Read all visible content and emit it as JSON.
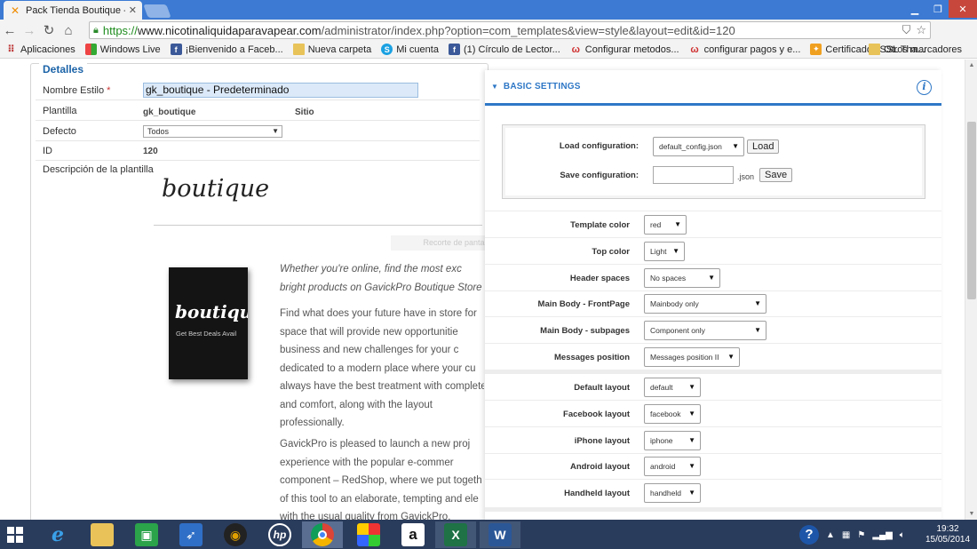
{
  "browser": {
    "tab_title": "Pack Tienda Boutique - A",
    "url_scheme": "https://",
    "url_host": "www.nicotinaliquidaparavapear.com",
    "url_path": "/administrator/index.php?option=com_templates&view=style&layout=edit&id=120",
    "bookmarks": [
      {
        "label": "Aplicaciones",
        "icon": "apps-grid-icon"
      },
      {
        "label": "Windows Live",
        "icon": "windows-logo-icon"
      },
      {
        "label": "¡Bienvenido a Faceb...",
        "icon": "facebook-icon"
      },
      {
        "label": "Nueva carpeta",
        "icon": "folder-icon"
      },
      {
        "label": "Mi cuenta",
        "icon": "skype-icon"
      },
      {
        "label": "(1) Círculo de Lector...",
        "icon": "facebook-icon"
      },
      {
        "label": "Configurar metodos...",
        "icon": "w-icon"
      },
      {
        "label": "configurar pagos y e...",
        "icon": "w-icon"
      },
      {
        "label": "Certificados SSL Tha...",
        "icon": "certificate-icon"
      }
    ],
    "other_bookmarks": "Otros marcadores"
  },
  "details": {
    "legend": "Detalles",
    "name_label": "Nombre Estilo",
    "name_required": "*",
    "name_value": "gk_boutique - Predeterminado",
    "template_label": "Plantilla",
    "template_value": "gk_boutique",
    "site_value": "Sitio",
    "default_label": "Defecto",
    "default_value": "Todos",
    "id_label": "ID",
    "id_value": "120",
    "description_label": "Descripción de la plantilla"
  },
  "preview": {
    "logo": "boutique",
    "screenshot_caption": "Recorte de pantalla completa",
    "product_title": "boutiqu",
    "product_subtitle": "Get Best Deals Avail",
    "paragraphs": [
      [
        "Whether you're online, find the most exc",
        "bright products on GavickPro Boutique Store"
      ],
      [
        "Find what does your future have in store for",
        "space that will provide new opportunitie",
        "business and new challenges for your c",
        "dedicated to a modern place where your cu",
        "always have the best treatment with complete",
        "and comfort, along with the layout",
        "professionally."
      ],
      [
        "GavickPro is pleased to launch a new proj",
        "experience with the popular e-commer",
        "component – RedShop, where we put togeth",
        "of this tool to an elaborate, tempting and ele",
        "with the usual quality from GavickPro."
      ]
    ]
  },
  "settings": {
    "title": "BASIC SETTINGS",
    "load_label": "Load configuration:",
    "load_value": "default_config.json",
    "load_button": "Load",
    "save_label": "Save configuration:",
    "save_input": "",
    "save_suffix": ".json",
    "save_button": "Save",
    "rows": [
      {
        "label": "Template color",
        "value": "red"
      },
      {
        "label": "Top color",
        "value": "Light"
      },
      {
        "label": "Header spaces",
        "value": "No spaces"
      },
      {
        "label": "Main Body - FrontPage",
        "value": "Mainbody only"
      },
      {
        "label": "Main Body - subpages",
        "value": "Component only"
      },
      {
        "label": "Messages position",
        "value": "Messages position II"
      },
      {
        "label": "Default layout",
        "value": "default"
      },
      {
        "label": "Facebook layout",
        "value": "facebook"
      },
      {
        "label": "iPhone layout",
        "value": "iphone"
      },
      {
        "label": "Android layout",
        "value": "android"
      },
      {
        "label": "Handheld layout",
        "value": "handheld"
      }
    ]
  },
  "taskbar": {
    "apps": [
      "start-icon",
      "internet-explorer-icon",
      "file-explorer-icon",
      "store-icon",
      "rocket-icon",
      "media-icon",
      "hp-icon",
      "chrome-icon",
      "paint-icon",
      "amazon-icon",
      "excel-icon",
      "word-icon"
    ],
    "time": "19:32",
    "date": "15/05/2014"
  },
  "colors": {
    "accent": "#2e77c6",
    "titlebar": "#3c7ad3",
    "taskbar": "#2a3c5c"
  }
}
